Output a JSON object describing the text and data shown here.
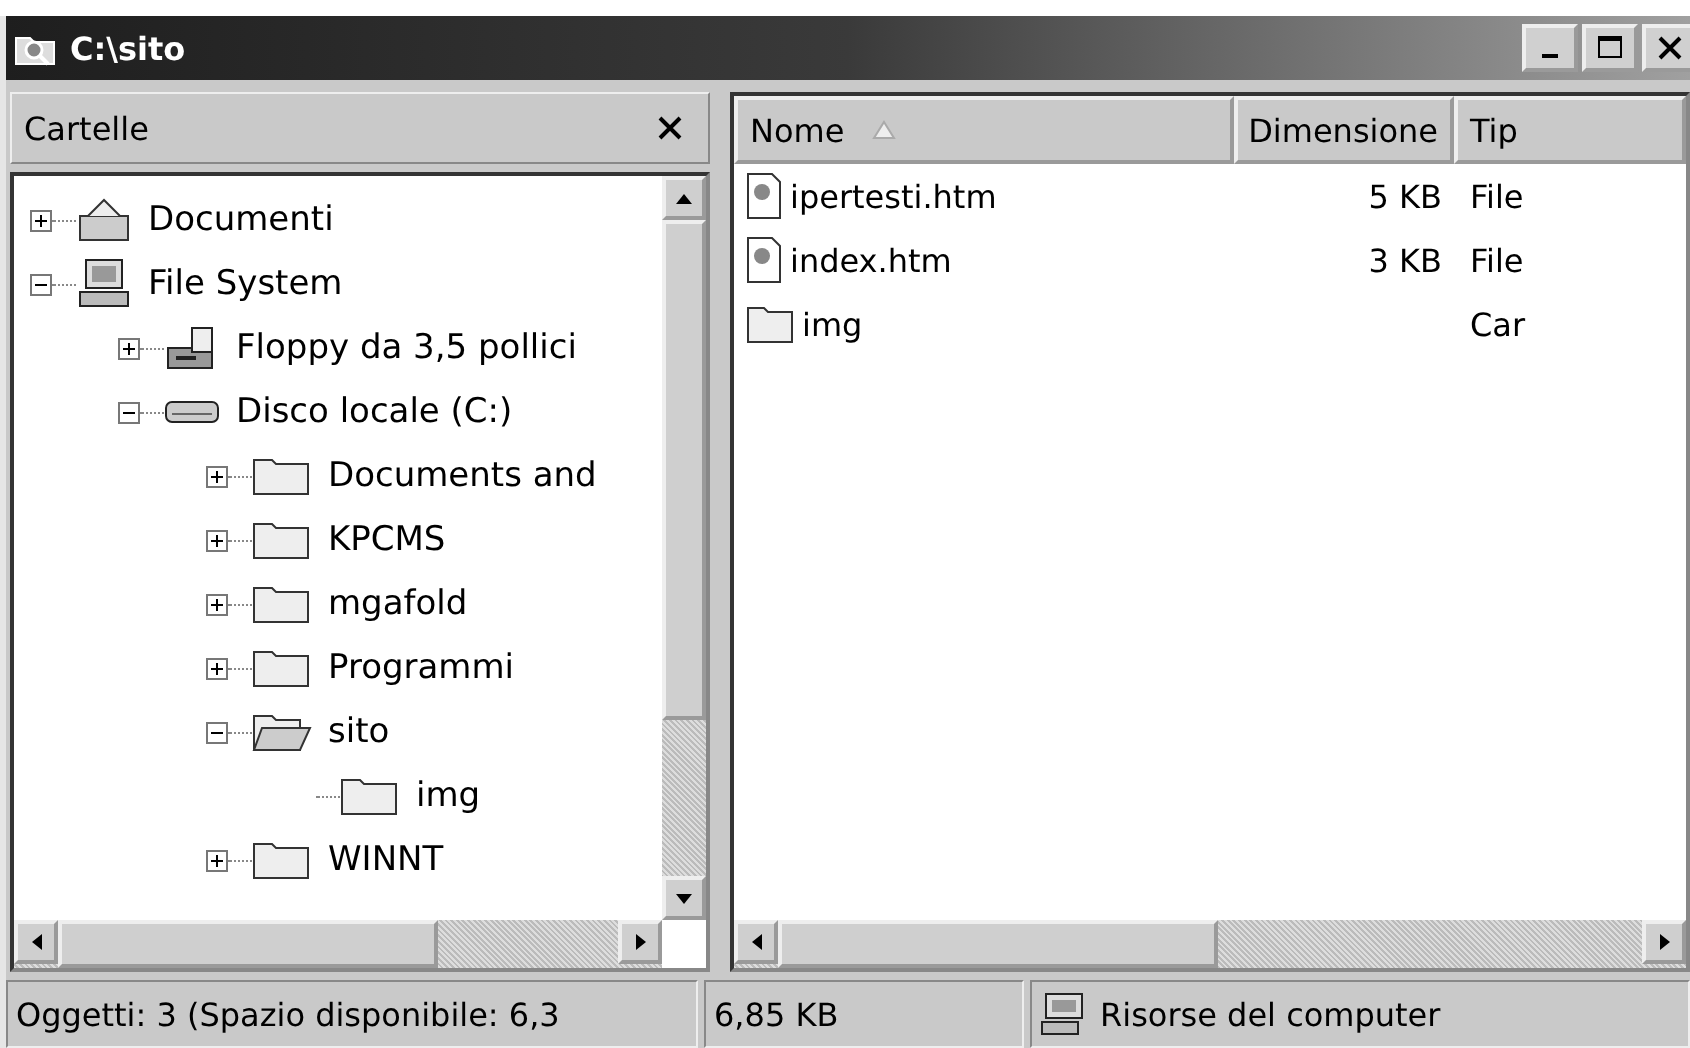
{
  "window": {
    "title": "C:\\sito"
  },
  "folders_pane": {
    "title": "Cartelle",
    "tree": [
      {
        "label": "Documenti",
        "kind": "documents",
        "expanded": false
      },
      {
        "label": "File System",
        "kind": "computer",
        "expanded": true,
        "children": [
          {
            "label": "Floppy da 3,5 pollici",
            "kind": "floppy",
            "expanded": false
          },
          {
            "label": "Disco locale (C:)",
            "kind": "drive",
            "expanded": true,
            "children": [
              {
                "label": "Documents and",
                "kind": "folder",
                "expanded": false
              },
              {
                "label": "KPCMS",
                "kind": "folder",
                "expanded": false
              },
              {
                "label": "mgafold",
                "kind": "folder",
                "expanded": false
              },
              {
                "label": "Programmi",
                "kind": "folder",
                "expanded": false
              },
              {
                "label": "sito",
                "kind": "folder-open",
                "expanded": true,
                "children": [
                  {
                    "label": "img",
                    "kind": "folder"
                  }
                ]
              },
              {
                "label": "WINNT",
                "kind": "folder",
                "expanded": false
              }
            ]
          }
        ]
      }
    ]
  },
  "file_list": {
    "columns": [
      {
        "label": "Nome",
        "sorted": true
      },
      {
        "label": "Dimensione",
        "sorted": false
      },
      {
        "label": "Tip",
        "sorted": false
      }
    ],
    "rows": [
      {
        "name": "ipertesti.htm",
        "kind": "html",
        "size": "5 KB",
        "type": "File"
      },
      {
        "name": "index.htm",
        "kind": "html",
        "size": "3 KB",
        "type": "File"
      },
      {
        "name": "img",
        "kind": "folder",
        "type": "Car"
      }
    ]
  },
  "status_bar": {
    "objects": "Oggetti: 3 (Spazio disponibile: 6,3",
    "size": "6,85 KB",
    "location": "Risorse del computer"
  }
}
